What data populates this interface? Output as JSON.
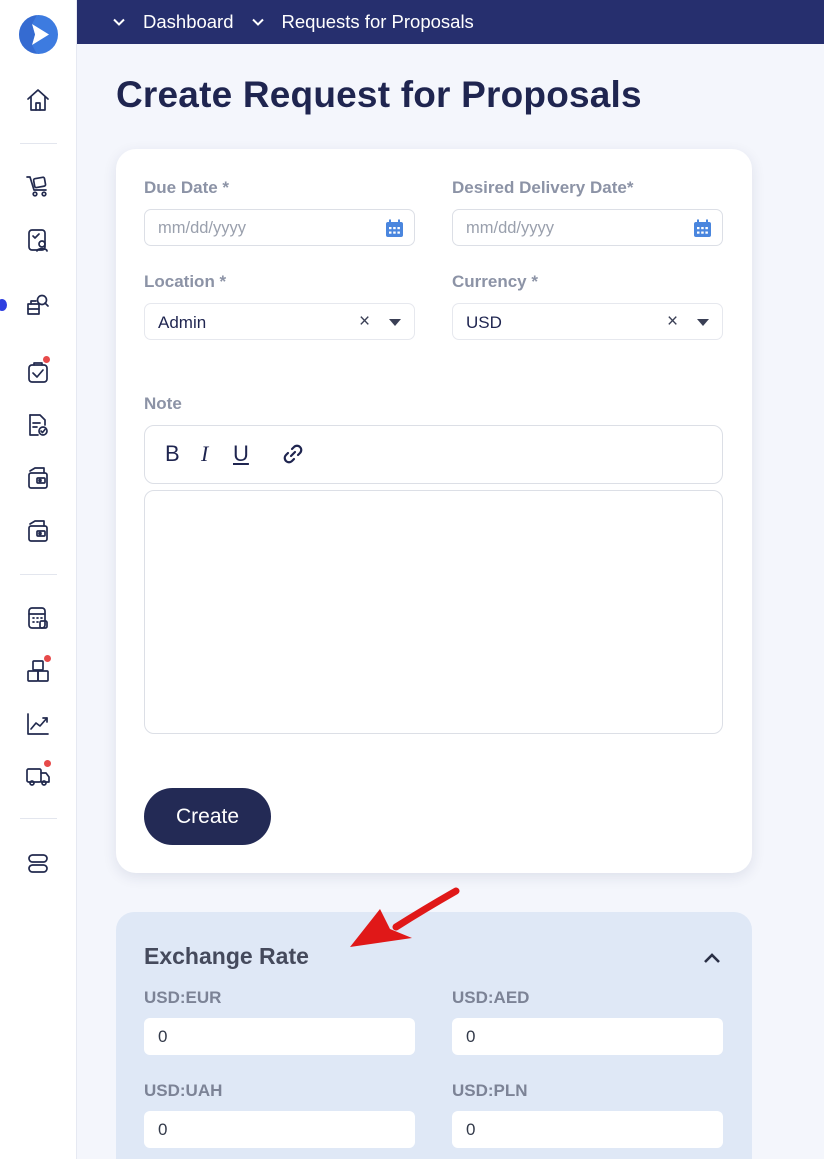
{
  "breadcrumbs": [
    "Dashboard",
    "Requests for Proposals"
  ],
  "page_title": "Create Request for Proposals",
  "form": {
    "due_date_label": "Due Date *",
    "due_date_placeholder": "mm/dd/yyyy",
    "delivery_date_label": "Desired Delivery Date*",
    "delivery_date_placeholder": "mm/dd/yyyy",
    "location_label": "Location *",
    "location_value": "Admin",
    "currency_label": "Currency *",
    "currency_value": "USD",
    "clear_symbol": "×",
    "note_label": "Note",
    "toolbar": {
      "bold": "B",
      "italic": "I",
      "underline": "U"
    },
    "create_label": "Create"
  },
  "exchange": {
    "title": "Exchange Rate",
    "rates": [
      {
        "label": "USD:EUR",
        "value": "0"
      },
      {
        "label": "USD:AED",
        "value": "0"
      },
      {
        "label": "USD:UAH",
        "value": "0"
      },
      {
        "label": "USD:PLN",
        "value": "0"
      }
    ]
  },
  "sidebar": {
    "icons": [
      "home-icon",
      "cart-icon",
      "contract-icon",
      "supplier-search-icon",
      "orders-check-icon",
      "document-check-icon",
      "wallet-icon",
      "wallet-icon-2",
      "calculator-icon",
      "inventory-boxes-icon",
      "analytics-chart-icon",
      "delivery-truck-icon",
      "settings-toggle-icon"
    ]
  },
  "colors": {
    "topbar": "#262f6e",
    "primary_button": "#232a55",
    "accent": "#3d7be0",
    "notification": "#e74a4a",
    "exchange_bg": "#dfe8f6"
  }
}
